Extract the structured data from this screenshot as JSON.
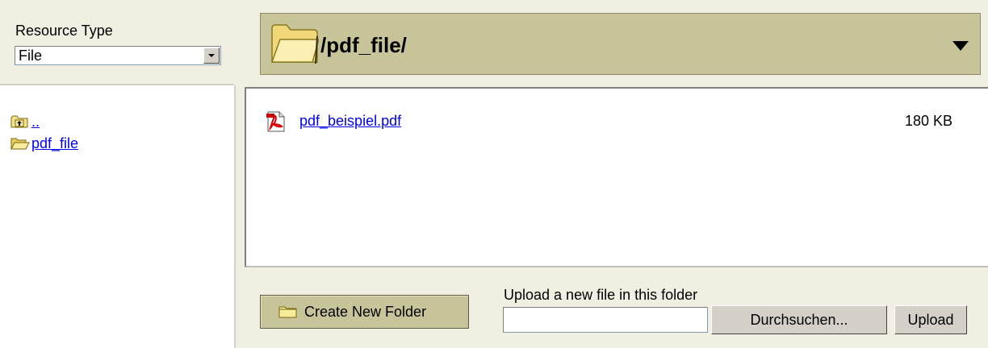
{
  "resource_type": {
    "label": "Resource Type",
    "selected": "File"
  },
  "tree": {
    "items": [
      {
        "label": "..",
        "icon": "folder-up-icon"
      },
      {
        "label": "pdf_file",
        "icon": "folder-open-icon"
      }
    ]
  },
  "path_bar": {
    "path": "/pdf_file/",
    "icon": "folder-open-icon"
  },
  "files": [
    {
      "name": "pdf_beispiel.pdf",
      "size": "180 KB",
      "icon": "pdf-icon"
    }
  ],
  "actions": {
    "create_folder_label": "Create New Folder",
    "upload_label": "Upload a new file in this folder",
    "upload_value": "",
    "browse_label": "Durchsuchen...",
    "upload_button_label": "Upload"
  },
  "colors": {
    "bar_bg": "#c8c49a",
    "page_bg": "#f1efe2",
    "link": "#0000ee"
  }
}
